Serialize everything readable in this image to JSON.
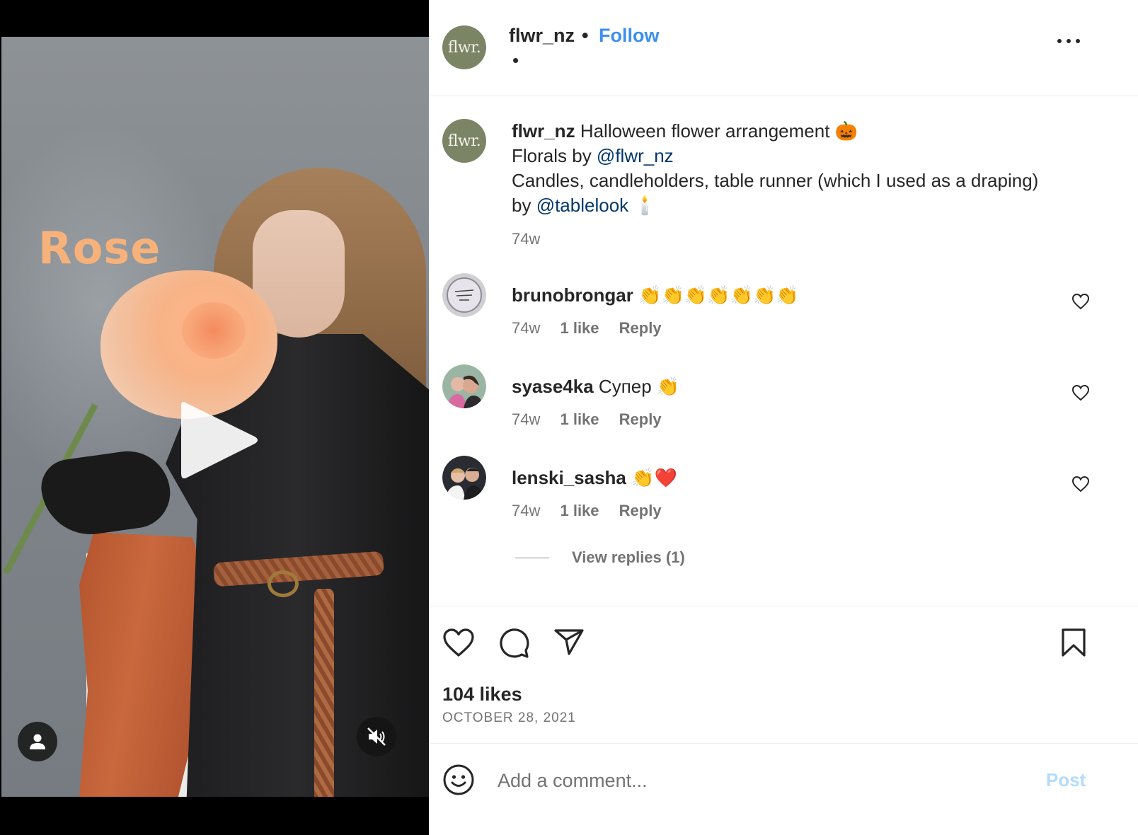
{
  "media": {
    "overlay_text": "Rose",
    "icons": {
      "play": "play-icon",
      "tag": "user-tag-icon",
      "mute": "muted-speaker-icon"
    }
  },
  "header": {
    "username": "flwr_nz",
    "separator": "•",
    "follow_label": "Follow",
    "subline": "•",
    "avatar_text": "flwr.",
    "more_icon": "more-options-icon"
  },
  "caption": {
    "username": "flwr_nz",
    "line1": "Halloween flower arrangement 🎃",
    "line2_prefix": "Florals by ",
    "line2_mention": "@flwr_nz",
    "line3": "Candles, candleholders, table runner (which I used as a draping)",
    "line4_prefix": "by ",
    "line4_mention": "@tablelook",
    "line4_suffix": " 🕯️",
    "time": "74w",
    "avatar_text": "flwr."
  },
  "comments": [
    {
      "username": "brunobrongar",
      "text": " 👏👏👏👏👏👏👏",
      "time": "74w",
      "likes": "1 like",
      "reply": "Reply"
    },
    {
      "username": "syase4ka",
      "text": " Супер 👏",
      "time": "74w",
      "likes": "1 like",
      "reply": "Reply"
    },
    {
      "username": "lenski_sasha",
      "text": " 👏❤️",
      "time": "74w",
      "likes": "1 like",
      "reply": "Reply"
    }
  ],
  "view_replies": "View replies (1)",
  "actions": {
    "icons": [
      "heart-icon",
      "comment-icon",
      "share-icon",
      "bookmark-icon"
    ],
    "likes": "104 likes",
    "date": "OCTOBER 28, 2021"
  },
  "add_comment": {
    "placeholder": "Add a comment...",
    "post_label": "Post",
    "emoji_icon": "emoji-icon"
  },
  "colors": {
    "follow": "#3c8ff0",
    "mention": "#00376b",
    "post_disabled": "#b3dbff",
    "secondary_text": "#737373",
    "overlay_text": "#f7b17a",
    "brand_avatar": "#7c8466"
  }
}
